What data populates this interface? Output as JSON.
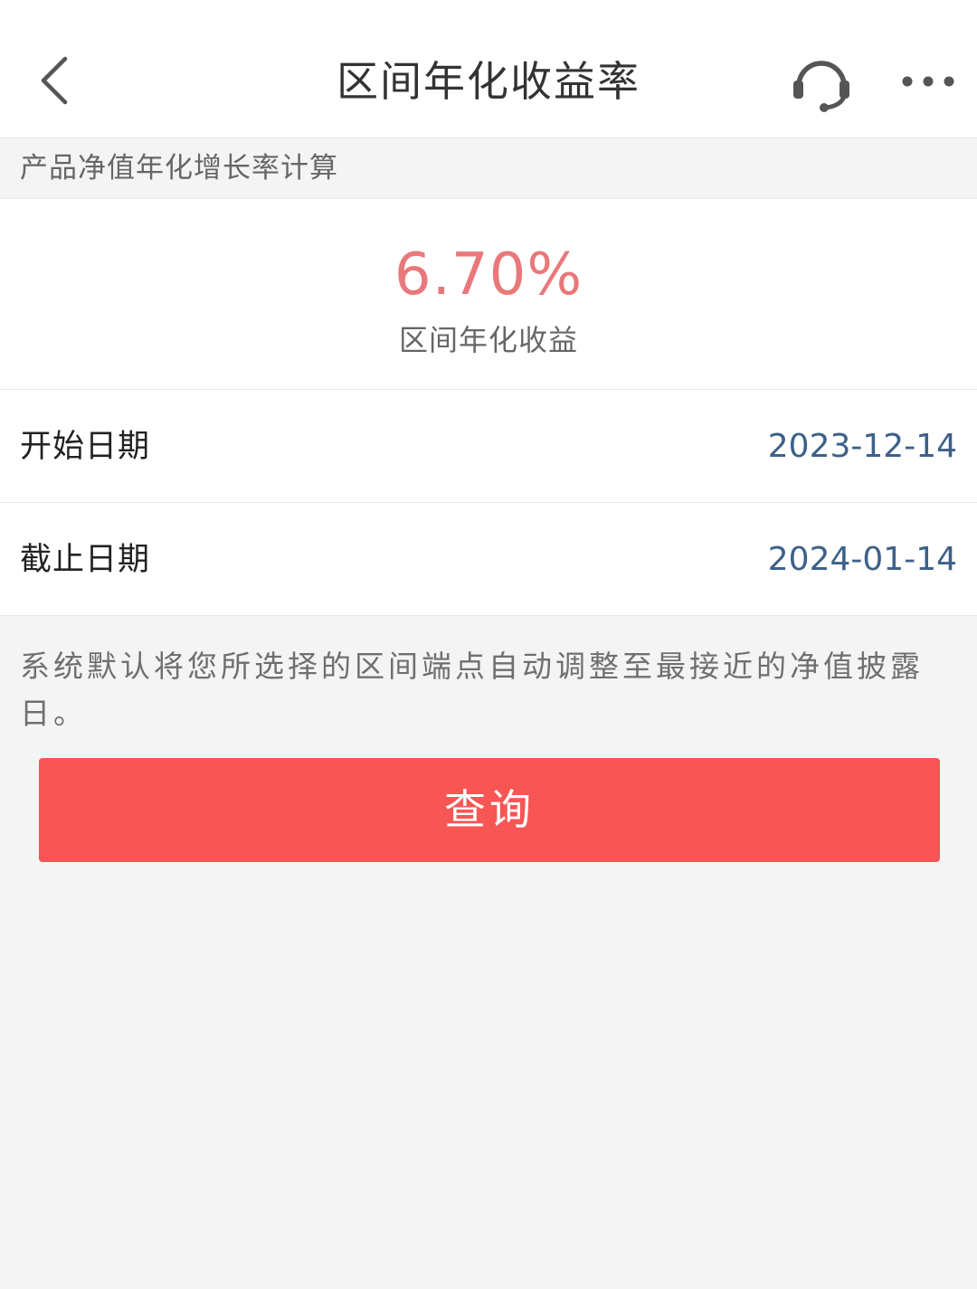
{
  "nav": {
    "title": "区间年化收益率"
  },
  "section": {
    "header": "产品净值年化增长率计算"
  },
  "result": {
    "value": "6.70%",
    "label": "区间年化收益"
  },
  "form": {
    "start_label": "开始日期",
    "start_value": "2023-12-14",
    "end_label": "截止日期",
    "end_value": "2024-01-14"
  },
  "notice": {
    "text": "系统默认将您所选择的区间端点自动调整至最接近的净值披露日。"
  },
  "actions": {
    "query_label": "查询"
  },
  "icons": {
    "back": "chevron-left-icon",
    "support": "headset-icon",
    "more": "more-horizontal-icon"
  },
  "colors": {
    "accent_button": "#f85555",
    "result_value": "#e9787a",
    "date_value": "#3c6189"
  }
}
